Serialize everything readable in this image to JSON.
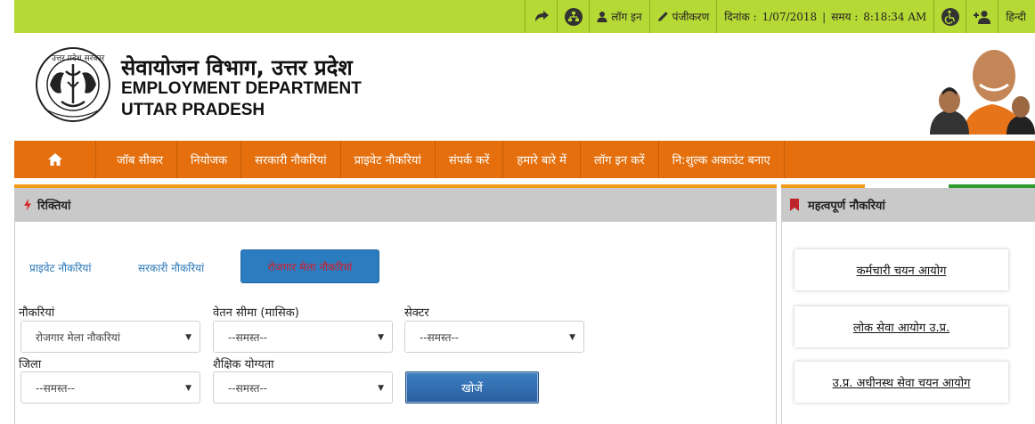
{
  "topbar": {
    "login": "लॉग इन",
    "register": "पंजीकरण",
    "date_label": "दिनांक :",
    "date_value": "1/07/2018",
    "sep": "|",
    "time_label": "समय :",
    "time_value": "8:18:34 AM",
    "language": "हिन्दी"
  },
  "header": {
    "title_hindi": "सेवायोजन विभाग, उत्तर प्रदेश",
    "title_en_line1": "EMPLOYMENT DEPARTMENT",
    "title_en_line2": "UTTAR PRADESH",
    "seal_text": "उत्तर प्रदेश सरकार"
  },
  "nav": {
    "items": [
      {
        "label": "जॉब सीकर"
      },
      {
        "label": "नियोजक"
      },
      {
        "label": "सरकारी नौकरियां"
      },
      {
        "label": "प्राइवेट नौकरियां"
      },
      {
        "label": "संपर्क करें"
      },
      {
        "label": "हमारे बारे में"
      },
      {
        "label": "लॉग इन करें"
      },
      {
        "label": "नि:शुल्क अकाउंट बनाए"
      }
    ]
  },
  "vacancies": {
    "title": "रिक्तियां",
    "tabs": [
      "प्राइवेट नौकरियां",
      "सरकारी नौकरियां",
      "रोजगार मेला नौकरियां"
    ],
    "filters": {
      "jobs_label": "नौकरियां",
      "jobs_value": "रोजगार मेला नौकरियां",
      "salary_label": "वेतन सीमा (मासिक)",
      "salary_value": "--समस्त--",
      "sector_label": "सेक्टर",
      "sector_value": "--समस्त--",
      "district_label": "जिला",
      "district_value": "--समस्त--",
      "qualification_label": "शैक्षिक योग्यता",
      "qualification_value": "--समस्त--"
    },
    "search_label": "खोजें"
  },
  "important_jobs": {
    "title": "महत्वपूर्ण नौकरियां",
    "items": [
      "कर्मचारी चयन आयोग",
      "लोक सेवा आयोग उ.प्र.",
      "उ.प्र. अधीनस्थ सेवा चयन आयोग"
    ]
  },
  "colors": {
    "topbar": "#b5d935",
    "nav": "#e46f0c",
    "panel_header": "#c9c9c9",
    "active_tab": "#2c7dc0",
    "search_button": "#2a609f"
  }
}
